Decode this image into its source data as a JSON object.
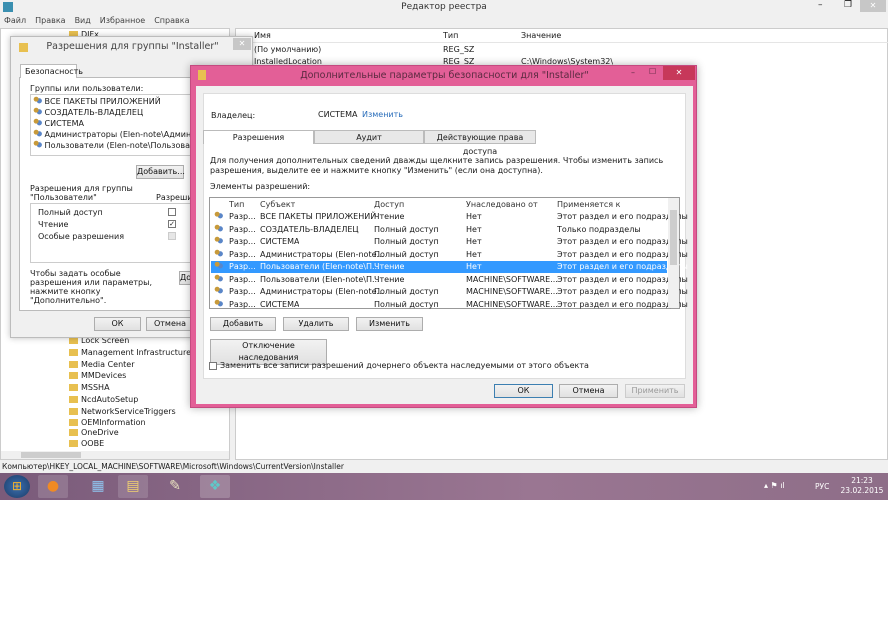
{
  "regedit": {
    "title": "Редактор реестра",
    "menu": [
      "Файл",
      "Правка",
      "Вид",
      "Избранное",
      "Справка"
    ],
    "columns": [
      "Имя",
      "Тип",
      "Значение"
    ],
    "rows": [
      {
        "name": "(По умолчанию)",
        "type": "REG_SZ",
        "value": ""
      },
      {
        "name": "InstalledLocation",
        "type": "REG_SZ",
        "value": "C:\\Windows\\System32\\"
      }
    ],
    "tree_top": "DIFx",
    "tree": [
      "Lock Screen",
      "Management Infrastructure",
      "Media Center",
      "MMDevices",
      "MSSHA",
      "NcdAutoSetup",
      "NetworkServiceTriggers",
      "OEMInformation",
      "OneDrive",
      "OOBE"
    ],
    "status": "Компьютер\\HKEY_LOCAL_MACHINE\\SOFTWARE\\Microsoft\\Windows\\CurrentVersion\\Installer"
  },
  "group_dialog": {
    "title": "Разрешения для группы \"Installer\"",
    "tab": "Безопасность",
    "groups_label": "Группы или пользователи:",
    "groups": [
      "ВСЕ ПАКЕТЫ ПРИЛОЖЕНИЙ",
      "СОЗДАТЕЛЬ-ВЛАДЕЛЕЦ",
      "СИСТЕМА",
      "Администраторы (Elen-note\\Администраторы)",
      "Пользователи (Elen-note\\Пользователи)"
    ],
    "add": "Добавить...",
    "perms_label_1": "Разрешения для группы",
    "perms_label_2": "\"Пользователи\"",
    "allow": "Разрешить",
    "perms": [
      {
        "name": "Полный доступ",
        "allow": false
      },
      {
        "name": "Чтение",
        "allow": true
      },
      {
        "name": "Особые разрешения",
        "allow": false
      }
    ],
    "note": "Чтобы задать особые разрешения или параметры, нажмите кнопку \"Дополнительно\".",
    "advanced": "Дополнительно",
    "ok": "ОК",
    "cancel": "Отмена"
  },
  "adv_dialog": {
    "title": "Дополнительные параметры безопасности  для \"Installer\"",
    "owner_label": "Владелец:",
    "owner": "СИСТЕМА",
    "change_owner": "Изменить",
    "tabs": [
      "Разрешения",
      "Аудит",
      "Действующие права доступа"
    ],
    "info": "Для получения дополнительных сведений дважды щелкните запись разрешения. Чтобы изменить запись разрешения, выделите ее и нажмите кнопку \"Изменить\" (если она доступна).",
    "entries_label": "Элементы разрешений:",
    "columns": [
      "Тип",
      "Субъект",
      "Доступ",
      "Унаследовано от",
      "Применяется к"
    ],
    "entries": [
      {
        "type": "Разр...",
        "subject": "ВСЕ ПАКЕТЫ ПРИЛОЖЕНИЙ",
        "access": "Чтение",
        "inherited": "Нет",
        "applies": "Этот раздел и его подразделы"
      },
      {
        "type": "Разр...",
        "subject": "СОЗДАТЕЛЬ-ВЛАДЕЛЕЦ",
        "access": "Полный доступ",
        "inherited": "Нет",
        "applies": "Только подразделы"
      },
      {
        "type": "Разр...",
        "subject": "СИСТЕМА",
        "access": "Полный доступ",
        "inherited": "Нет",
        "applies": "Этот раздел и его подразделы"
      },
      {
        "type": "Разр...",
        "subject": "Администраторы (Elen-note...",
        "access": "Полный доступ",
        "inherited": "Нет",
        "applies": "Этот раздел и его подразделы"
      },
      {
        "type": "Разр...",
        "subject": "Пользователи (Elen-note\\П...",
        "access": "Чтение",
        "inherited": "Нет",
        "applies": "Этот раздел и его подразделы",
        "selected": true
      },
      {
        "type": "Разр...",
        "subject": "Пользователи (Elen-note\\П...",
        "access": "Чтение",
        "inherited": "MACHINE\\SOFTWARE...",
        "applies": "Этот раздел и его подразделы"
      },
      {
        "type": "Разр...",
        "subject": "Администраторы (Elen-note...",
        "access": "Полный доступ",
        "inherited": "MACHINE\\SOFTWARE...",
        "applies": "Этот раздел и его подразделы"
      },
      {
        "type": "Разр...",
        "subject": "СИСТЕМА",
        "access": "Полный доступ",
        "inherited": "MACHINE\\SOFTWARE...",
        "applies": "Этот раздел и его подразделы"
      }
    ],
    "add": "Добавить",
    "remove": "Удалить",
    "edit": "Изменить",
    "disable_inheritance": "Отключение наследования",
    "replace_label": "Заменить все записи разрешений дочернего объекта наследуемыми от этого объекта",
    "replace_checked": false,
    "ok": "ОК",
    "cancel": "Отмена",
    "apply": "Применить"
  },
  "taskbar": {
    "lang": "РУС",
    "time": "21:23",
    "date": "23.02.2015",
    "color": "#8a6a86"
  },
  "colors": {
    "dialog_border": "#e35f97",
    "selection": "#3399ff",
    "link": "#2a6ebb"
  }
}
